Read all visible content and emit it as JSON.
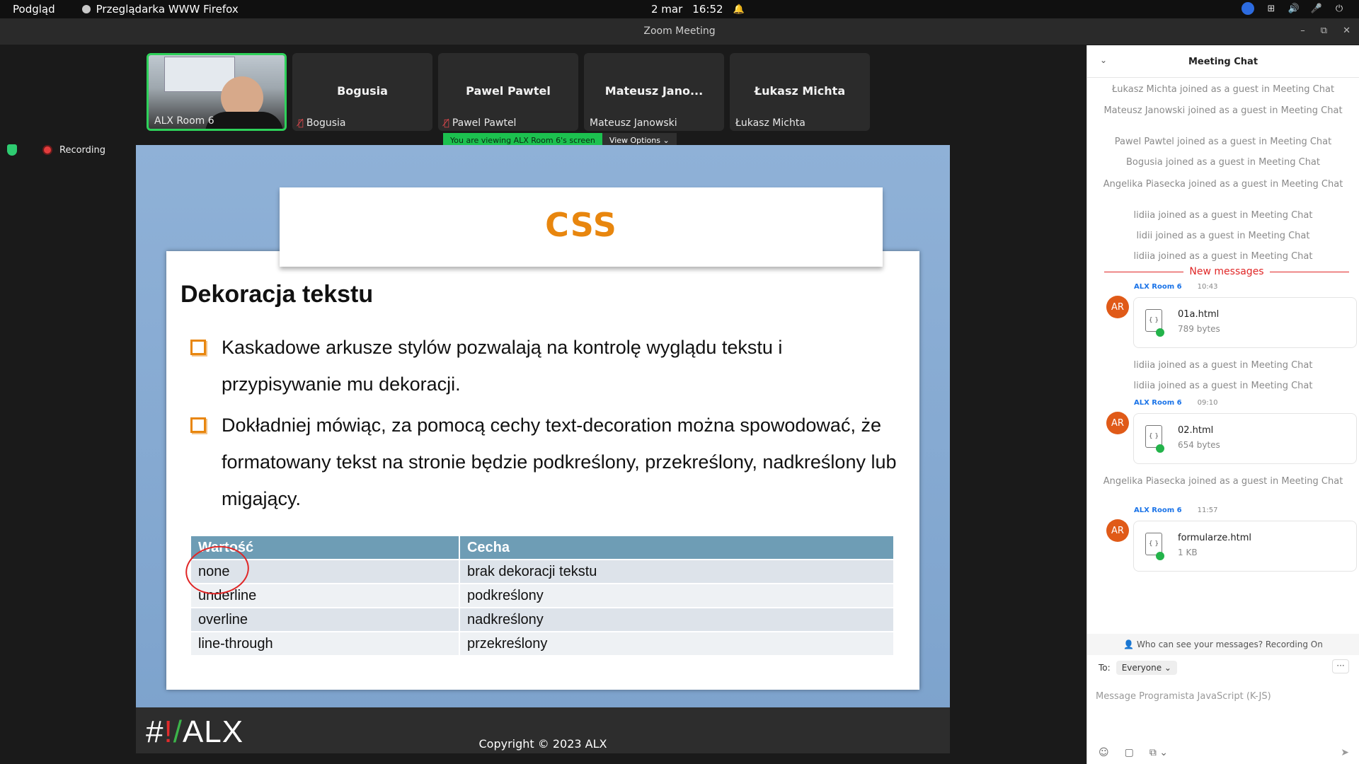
{
  "system_bar": {
    "app_menu": "Podgląd",
    "active_app": "Przeglądarka WWW Firefox",
    "date": "2 mar",
    "time": "16:52"
  },
  "window": {
    "title": "Zoom Meeting",
    "minimize": "–",
    "restore": "⧉",
    "close": "✕"
  },
  "participants": [
    {
      "display": "",
      "label": "ALX Room 6",
      "muted": false,
      "active": true
    },
    {
      "display": "Bogusia",
      "label": "Bogusia",
      "muted": true
    },
    {
      "display": "Pawel Pawtel",
      "label": "Pawel Pawtel",
      "muted": true
    },
    {
      "display": "Mateusz Jano...",
      "label": "Mateusz Janowski",
      "muted": false
    },
    {
      "display": "Łukasz Michta",
      "label": "Łukasz Michta",
      "muted": false
    }
  ],
  "share_banner": {
    "message": "You are viewing ALX Room 6's screen",
    "options": "View Options ⌄"
  },
  "recording": {
    "label": "Recording"
  },
  "slide": {
    "title": "CSS",
    "heading": "Dekoracja tekstu",
    "bullets": [
      "Kaskadowe arkusze stylów pozwalają na kontrolę wyglądu tekstu i przypisywanie mu dekoracji.",
      "Dokładniej mówiąc, za pomocą cechy text-decoration można spowodować, że formatowany tekst na stronie będzie podkreślony, przekreślony, nadkreślony lub migający."
    ],
    "table": {
      "headers": [
        "Wartość",
        "Cecha"
      ],
      "rows": [
        [
          "none",
          "brak dekoracji tekstu"
        ],
        [
          "underline",
          "podkreślony"
        ],
        [
          "overline",
          "nadkreślony"
        ],
        [
          "line-through",
          "przekreślony"
        ]
      ]
    },
    "logo_hash": "#",
    "logo_bang": "!",
    "logo_slash": "/",
    "logo_text": "ALX",
    "copyright": "Copyright © 2023 ALX"
  },
  "chat": {
    "title": "Meeting Chat",
    "system_messages_top": [
      "Łukasz Michta joined as a guest in Meeting Chat",
      "Mateusz Janowski joined as a guest in Meeting Chat",
      "Pawel Pawtel joined as a guest in Meeting Chat",
      "Bogusia joined as a guest in Meeting Chat",
      "Angelika Piasecka joined as a guest in Meeting Chat",
      "lidiia joined as a guest in Meeting Chat",
      "lidii joined as a guest in Meeting Chat",
      "lidiia joined as a guest in Meeting Chat"
    ],
    "new_messages": "New messages",
    "messages": [
      {
        "sender": "ALX Room 6",
        "time": "10:43",
        "avatar": "AR",
        "file": "01a.html",
        "size": "789 bytes"
      },
      {
        "sender": "ALX Room 6",
        "time": "09:10",
        "avatar": "AR",
        "file": "02.html",
        "size": "654 bytes"
      },
      {
        "sender": "ALX Room 6",
        "time": "11:57",
        "avatar": "AR",
        "file": "formularze.html",
        "size": "1 KB"
      }
    ],
    "system_messages_mid": [
      "lidiia joined as a guest in Meeting Chat",
      "lidiia joined as a guest in Meeting Chat"
    ],
    "system_message_late": "Angelika Piasecka joined as a guest in Meeting Chat",
    "visibility": "Who can see your messages? Recording On",
    "to_label": "To:",
    "to_value": "Everyone ⌄",
    "more": "···",
    "input_placeholder": "Message Programista JavaScript (K-JS)"
  }
}
